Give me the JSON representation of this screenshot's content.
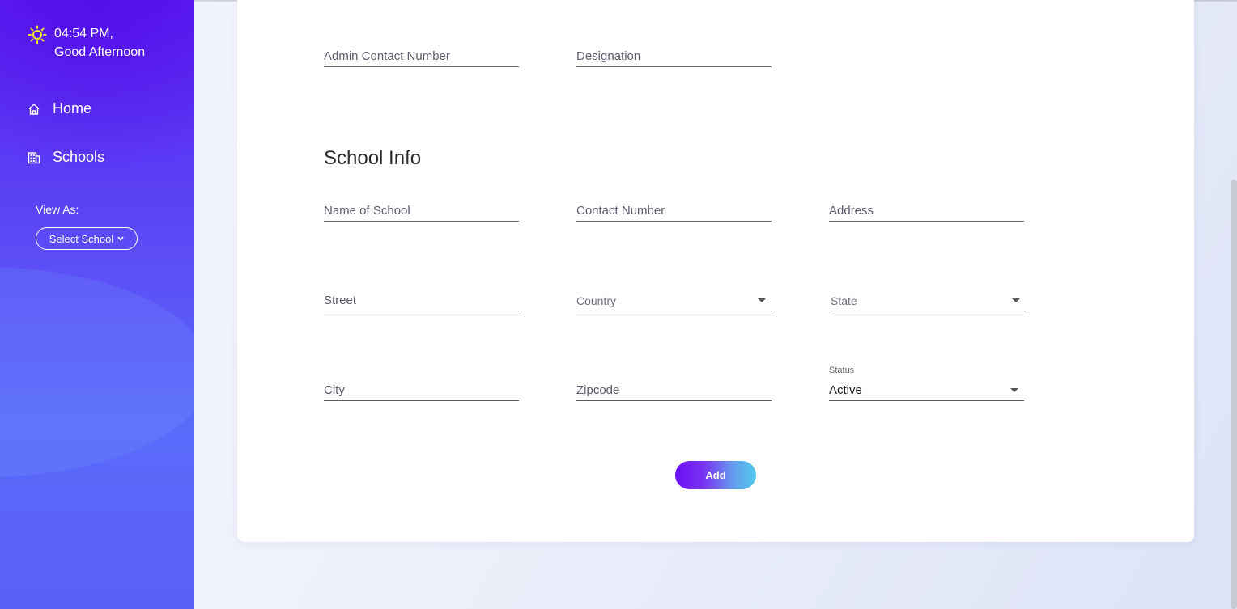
{
  "sidebar": {
    "time": "04:54 PM,",
    "greeting": "Good Afternoon",
    "nav": [
      {
        "label": "Home",
        "icon": "home-icon"
      },
      {
        "label": "Schools",
        "icon": "building-icon"
      }
    ],
    "view_as_label": "View As:",
    "school_select": "Select School"
  },
  "admin": {
    "contact_number_placeholder": "Admin Contact Number",
    "designation_placeholder": "Designation"
  },
  "school_info": {
    "title": "School Info",
    "name_placeholder": "Name of School",
    "contact_placeholder": "Contact Number",
    "address_placeholder": "Address",
    "street_placeholder": "Street",
    "country_placeholder": "Country",
    "state_placeholder": "State",
    "city_placeholder": "City",
    "zipcode_placeholder": "Zipcode",
    "status_label": "Status",
    "status_value": "Active"
  },
  "actions": {
    "add_label": "Add"
  },
  "colors": {
    "sidebar_top": "#5a1ff0",
    "sidebar_bottom": "#5a6bfa",
    "button_start": "#6a0ef5",
    "button_end": "#52c8eb",
    "sun": "#f4e531"
  }
}
